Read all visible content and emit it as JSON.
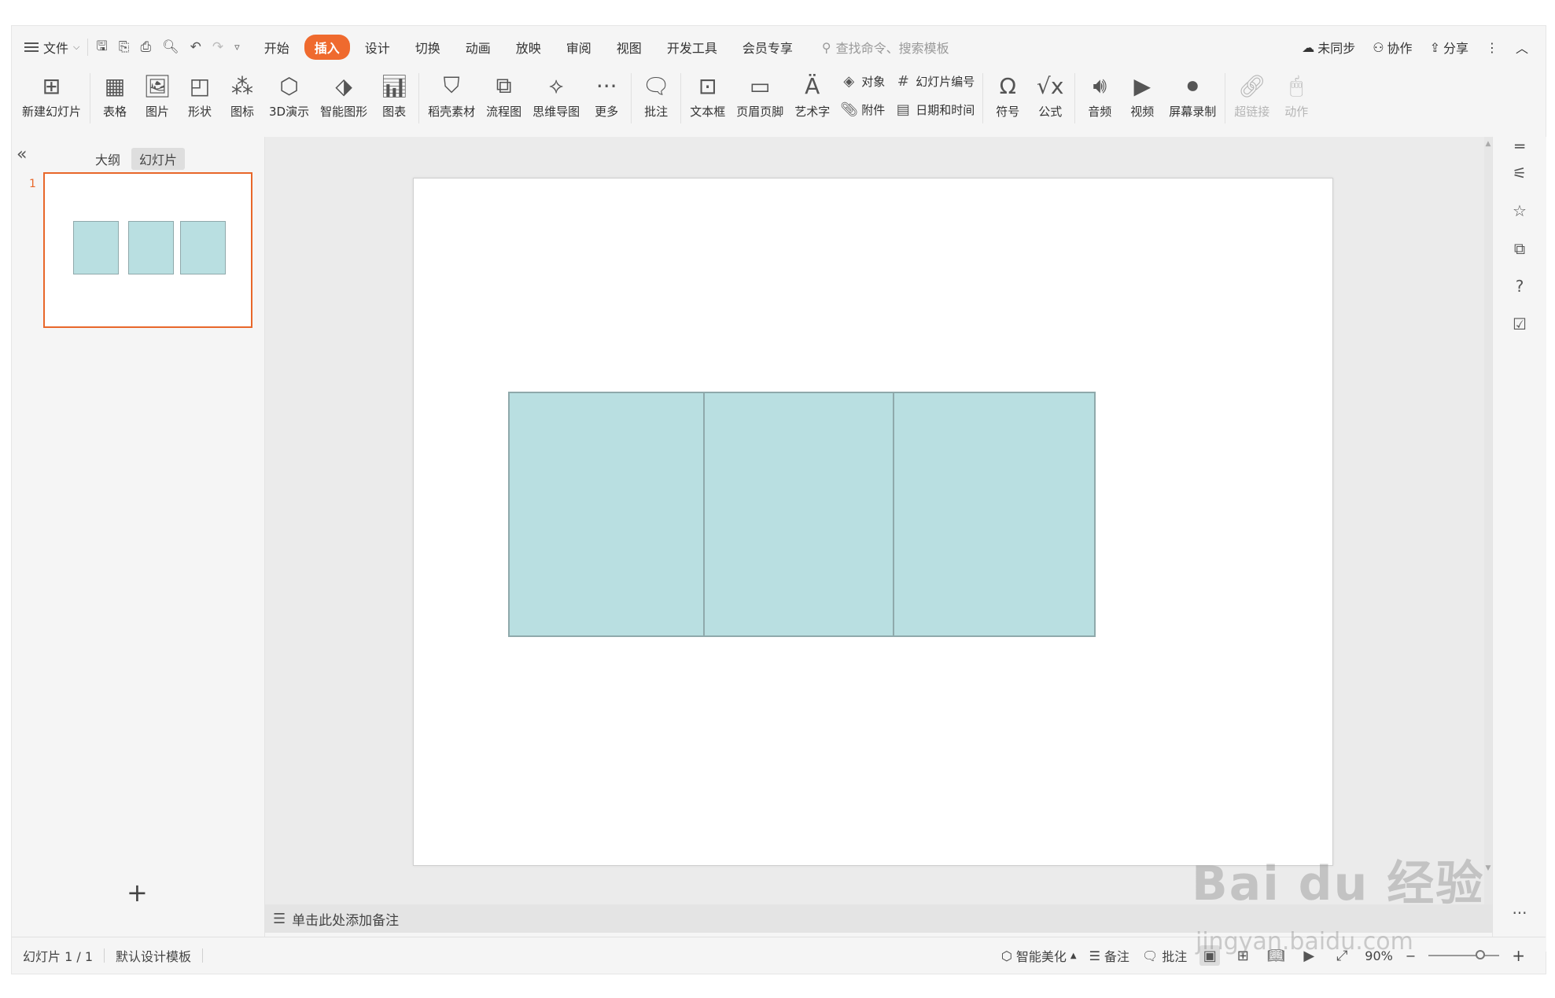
{
  "menu": {
    "file_label": "文件",
    "tabs": [
      "开始",
      "插入",
      "设计",
      "切换",
      "动画",
      "放映",
      "审阅",
      "视图",
      "开发工具",
      "会员专享"
    ],
    "active_tab": "插入",
    "search_placeholder": "查找命令、搜索模板",
    "sync_label": "未同步",
    "collab_label": "协作",
    "share_label": "分享"
  },
  "ribbon": {
    "new_slide": "新建幻灯片",
    "table": "表格",
    "picture": "图片",
    "shape": "形状",
    "icon": "图标",
    "demo3d": "3D演示",
    "smart_graphic": "智能图形",
    "chart": "图表",
    "daoke": "稻壳素材",
    "flowchart": "流程图",
    "mindmap": "思维导图",
    "more": "更多",
    "comment": "批注",
    "textbox": "文本框",
    "header_footer": "页眉页脚",
    "wordart": "艺术字",
    "object": "对象",
    "attachment": "附件",
    "slide_number": "幻灯片编号",
    "datetime": "日期和时间",
    "symbol": "符号",
    "formula": "公式",
    "audio": "音频",
    "video": "视频",
    "screen_record": "屏幕录制",
    "hyperlink": "超链接",
    "action": "动作"
  },
  "panel": {
    "outline_tab": "大纲",
    "slides_tab": "幻灯片",
    "slide_number": "1"
  },
  "notes": {
    "placeholder": "单击此处添加备注"
  },
  "status": {
    "slide_info": "幻灯片 1 / 1",
    "template": "默认设计模板",
    "beautify": "智能美化",
    "notes": "备注",
    "comments": "批注",
    "zoom": "90%"
  },
  "colors": {
    "accent": "#ef6a2e",
    "shape_fill": "#b9dfe1",
    "shape_border": "#8fa9ab"
  },
  "watermark": {
    "brand": "Bai du 经验",
    "url": "jingyan.baidu.com"
  }
}
